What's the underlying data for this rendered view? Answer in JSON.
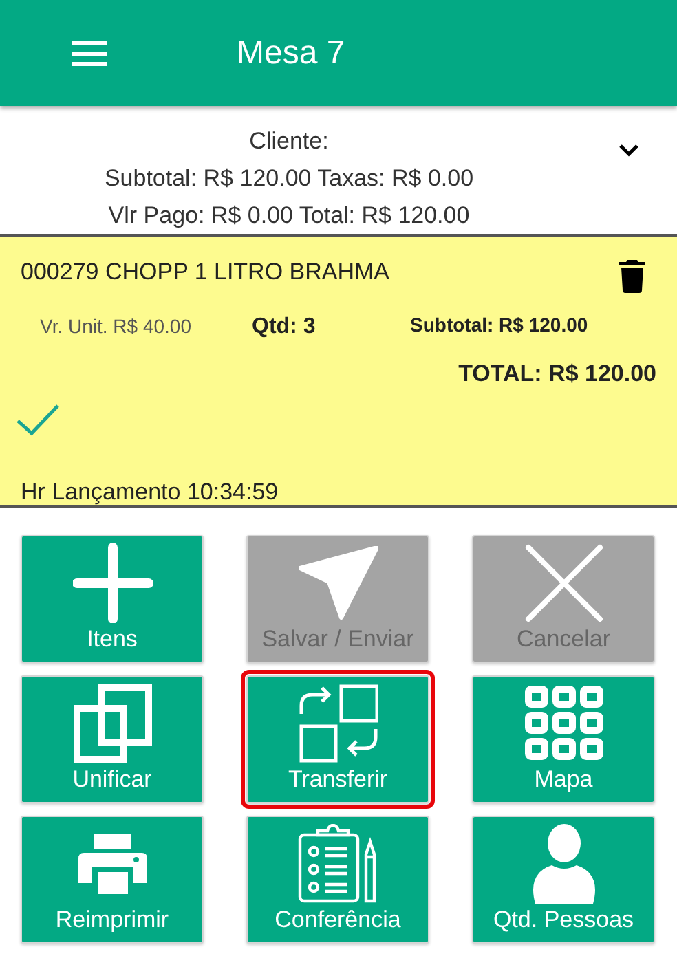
{
  "header": {
    "title": "Mesa 7"
  },
  "summary": {
    "lines": [
      "Cliente:",
      "Subtotal: R$ 120.00 Taxas: R$ 0.00",
      "Vlr Pago: R$ 0.00 Total: R$ 120.00"
    ],
    "expanded": false
  },
  "item": {
    "name": "000279 CHOPP 1 LITRO BRAHMA",
    "unit_price": "Vr. Unit. R$ 40.00",
    "quantity": "Qtd: 3",
    "subtotal": "Subtotal: R$ 120.00",
    "total": "TOTAL: R$ 120.00",
    "confirmed": true,
    "launch_time": "Hr Lançamento 10:34:59"
  },
  "actions": [
    {
      "label": "Itens",
      "kind": "plus",
      "disabled": false,
      "selected": false
    },
    {
      "label": "Salvar / Enviar",
      "kind": "send",
      "disabled": true,
      "selected": false
    },
    {
      "label": "Cancelar",
      "kind": "close",
      "disabled": true,
      "selected": false
    },
    {
      "label": "Unificar",
      "kind": "merge",
      "disabled": false,
      "selected": false
    },
    {
      "label": "Transferir",
      "kind": "transfer",
      "disabled": false,
      "selected": true
    },
    {
      "label": "Mapa",
      "kind": "grid",
      "disabled": false,
      "selected": false
    },
    {
      "label": "Reimprimir",
      "kind": "printer",
      "disabled": false,
      "selected": false
    },
    {
      "label": "Conferência",
      "kind": "checklist",
      "disabled": false,
      "selected": false
    },
    {
      "label": "Qtd. Pessoas",
      "kind": "person",
      "disabled": false,
      "selected": false
    }
  ]
}
